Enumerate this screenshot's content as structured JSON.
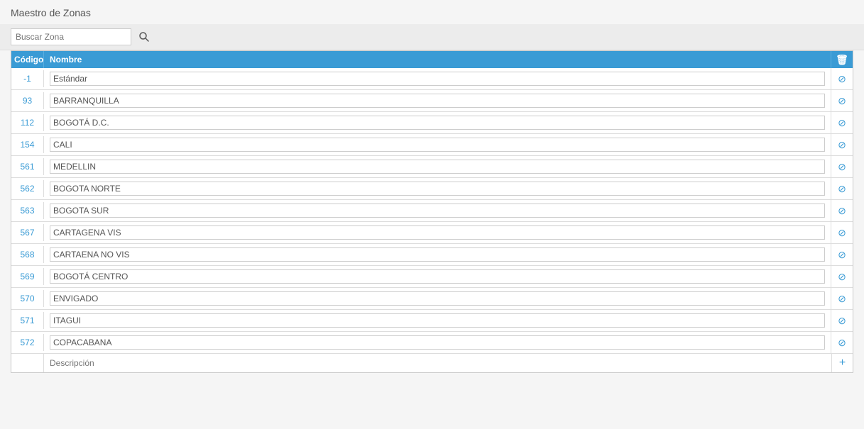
{
  "title": "Maestro de Zonas",
  "search": {
    "placeholder": "Buscar Zona"
  },
  "table": {
    "headers": {
      "codigo": "Código",
      "nombre": "Nombre"
    },
    "rows": [
      {
        "codigo": "-1",
        "nombre": "Estándar"
      },
      {
        "codigo": "93",
        "nombre": "BARRANQUILLA"
      },
      {
        "codigo": "112",
        "nombre": "BOGOTÁ D.C."
      },
      {
        "codigo": "154",
        "nombre": "CALI"
      },
      {
        "codigo": "561",
        "nombre": "MEDELLIN"
      },
      {
        "codigo": "562",
        "nombre": "BOGOTA NORTE"
      },
      {
        "codigo": "563",
        "nombre": "BOGOTA SUR"
      },
      {
        "codigo": "567",
        "nombre": "CARTAGENA VIS"
      },
      {
        "codigo": "568",
        "nombre": "CARTAENA NO VIS"
      },
      {
        "codigo": "569",
        "nombre": "BOGOTÁ CENTRO"
      },
      {
        "codigo": "570",
        "nombre": "ENVIGADO"
      },
      {
        "codigo": "571",
        "nombre": "ITAGUI"
      },
      {
        "codigo": "572",
        "nombre": "COPACABANA"
      }
    ],
    "add_placeholder": "Descripción"
  },
  "icons": {
    "search": "🔍",
    "trash": "🗑",
    "ban": "⊘",
    "plus": "+"
  }
}
